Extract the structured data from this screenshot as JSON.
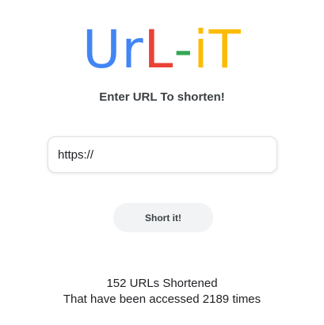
{
  "logo": {
    "letters": [
      {
        "char": "U",
        "color": "#4285F4"
      },
      {
        "char": "r",
        "color": "#4285F4"
      },
      {
        "char": "L",
        "color": "#EA4335"
      },
      {
        "char": "-",
        "color": "#34A853"
      },
      {
        "char": "i",
        "color": "#FBBC05"
      },
      {
        "char": "T",
        "color": "#FBBC05"
      }
    ],
    "text": "UrL-iT"
  },
  "subtitle": "Enter URL To shorten!",
  "url_input": {
    "value": "https://",
    "placeholder": ""
  },
  "short_button": {
    "label": "Short it!"
  },
  "stats": {
    "line1": "152 URLs Shortened",
    "line2": "That have been accessed 2189 times"
  },
  "colors": {
    "blue": "#4285F4",
    "red": "#EA4335",
    "green": "#34A853",
    "yellow": "#FBBC05",
    "button_bg": "#f1f3f4"
  }
}
